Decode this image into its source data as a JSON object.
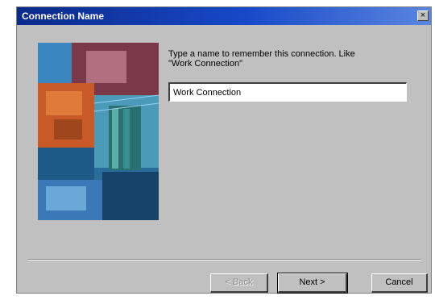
{
  "window": {
    "title": "Connection Name",
    "close_glyph": "×"
  },
  "prompt": {
    "line1": "Type a name to remember this connection.  Like",
    "line2": "\"Work Connection\""
  },
  "name_input": {
    "value": "Work Connection"
  },
  "buttons": {
    "back": "< Back",
    "next": "Next >",
    "cancel": "Cancel"
  },
  "colors": {
    "titlebar_start": "#0a2a8a",
    "titlebar_end": "#5a86e0",
    "dialog_face": "#c0c0c0"
  },
  "icons": {
    "close": "close-icon"
  }
}
